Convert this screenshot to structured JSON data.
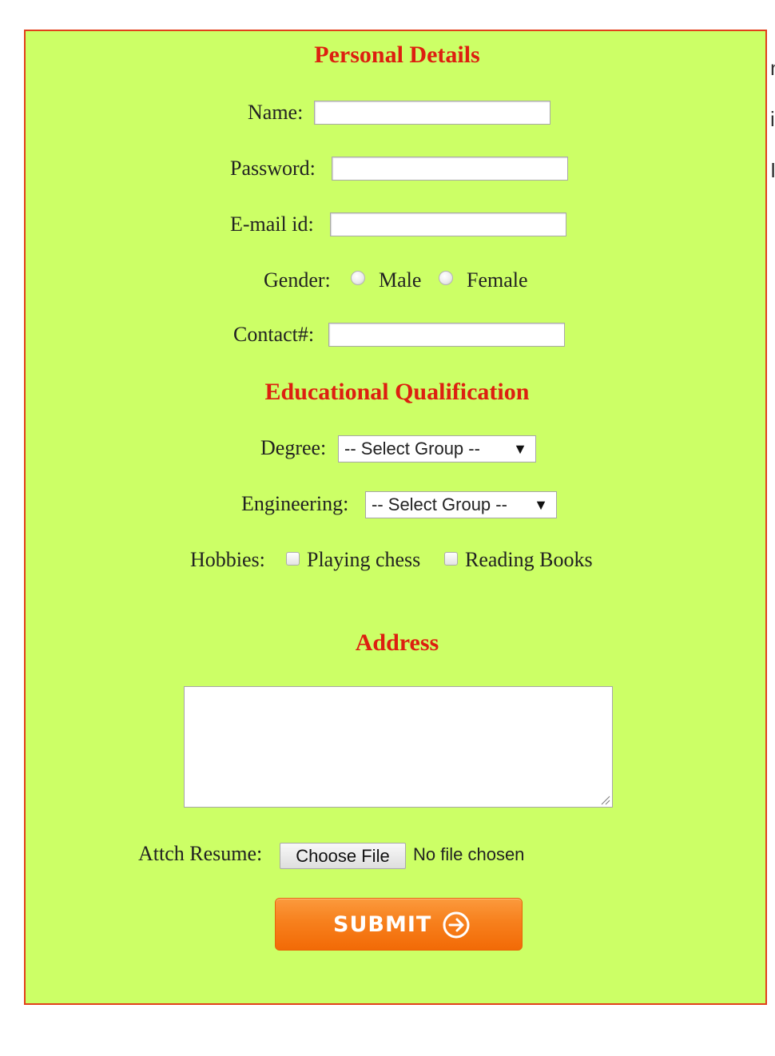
{
  "right_clipped_text": [
    "n",
    "i",
    "I"
  ],
  "personal": {
    "title": "Personal Details",
    "name_label": "Name:",
    "password_label": "Password:",
    "email_label": "E-mail id:",
    "gender_label": "Gender:",
    "gender_male": "Male",
    "gender_female": "Female",
    "contact_label": "Contact#:"
  },
  "education": {
    "title": "Educational Qualification",
    "degree_label": "Degree:",
    "degree_value": "-- Select Group --",
    "engineering_label": "Engineering:",
    "engineering_value": "-- Select Group --",
    "hobbies_label": "Hobbies:",
    "hobby_chess": "Playing chess",
    "hobby_books": "Reading Books"
  },
  "address": {
    "title": "Address"
  },
  "resume": {
    "label": "Attch Resume:",
    "button": "Choose File",
    "status": "No file chosen"
  },
  "submit": {
    "label": "SUBMIT",
    "icon": "arrow-circle-right-icon"
  },
  "colors": {
    "panel_background": "#ccff66",
    "panel_border": "#e2401b",
    "heading": "#dd1f10",
    "submit": "#f7801d"
  }
}
